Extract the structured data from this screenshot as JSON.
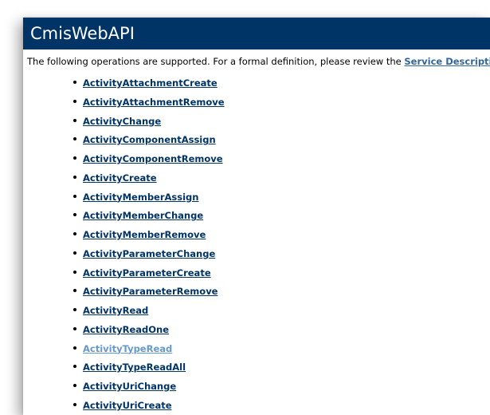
{
  "header": {
    "title": "CmisWebAPI"
  },
  "intro": {
    "text": "The following operations are supported. For a formal definition, please review the ",
    "link_label": "Service Description",
    "suffix": "."
  },
  "operations": [
    "ActivityAttachmentCreate",
    "ActivityAttachmentRemove",
    "ActivityChange",
    "ActivityComponentAssign",
    "ActivityComponentRemove",
    "ActivityCreate",
    "ActivityMemberAssign",
    "ActivityMemberChange",
    "ActivityMemberRemove",
    "ActivityParameterChange",
    "ActivityParameterCreate",
    "ActivityParameterRemove",
    "ActivityRead",
    "ActivityReadOne",
    "ActivityTypeRead",
    "ActivityTypeReadAll",
    "ActivityUriChange",
    "ActivityUriCreate"
  ],
  "visited_operations": [
    "ActivityTypeRead"
  ],
  "colors": {
    "header_bg": "#003366",
    "header_text": "#ffffff",
    "link": "#003366",
    "visited_link": "#6699cc",
    "service_link": "#336699"
  }
}
